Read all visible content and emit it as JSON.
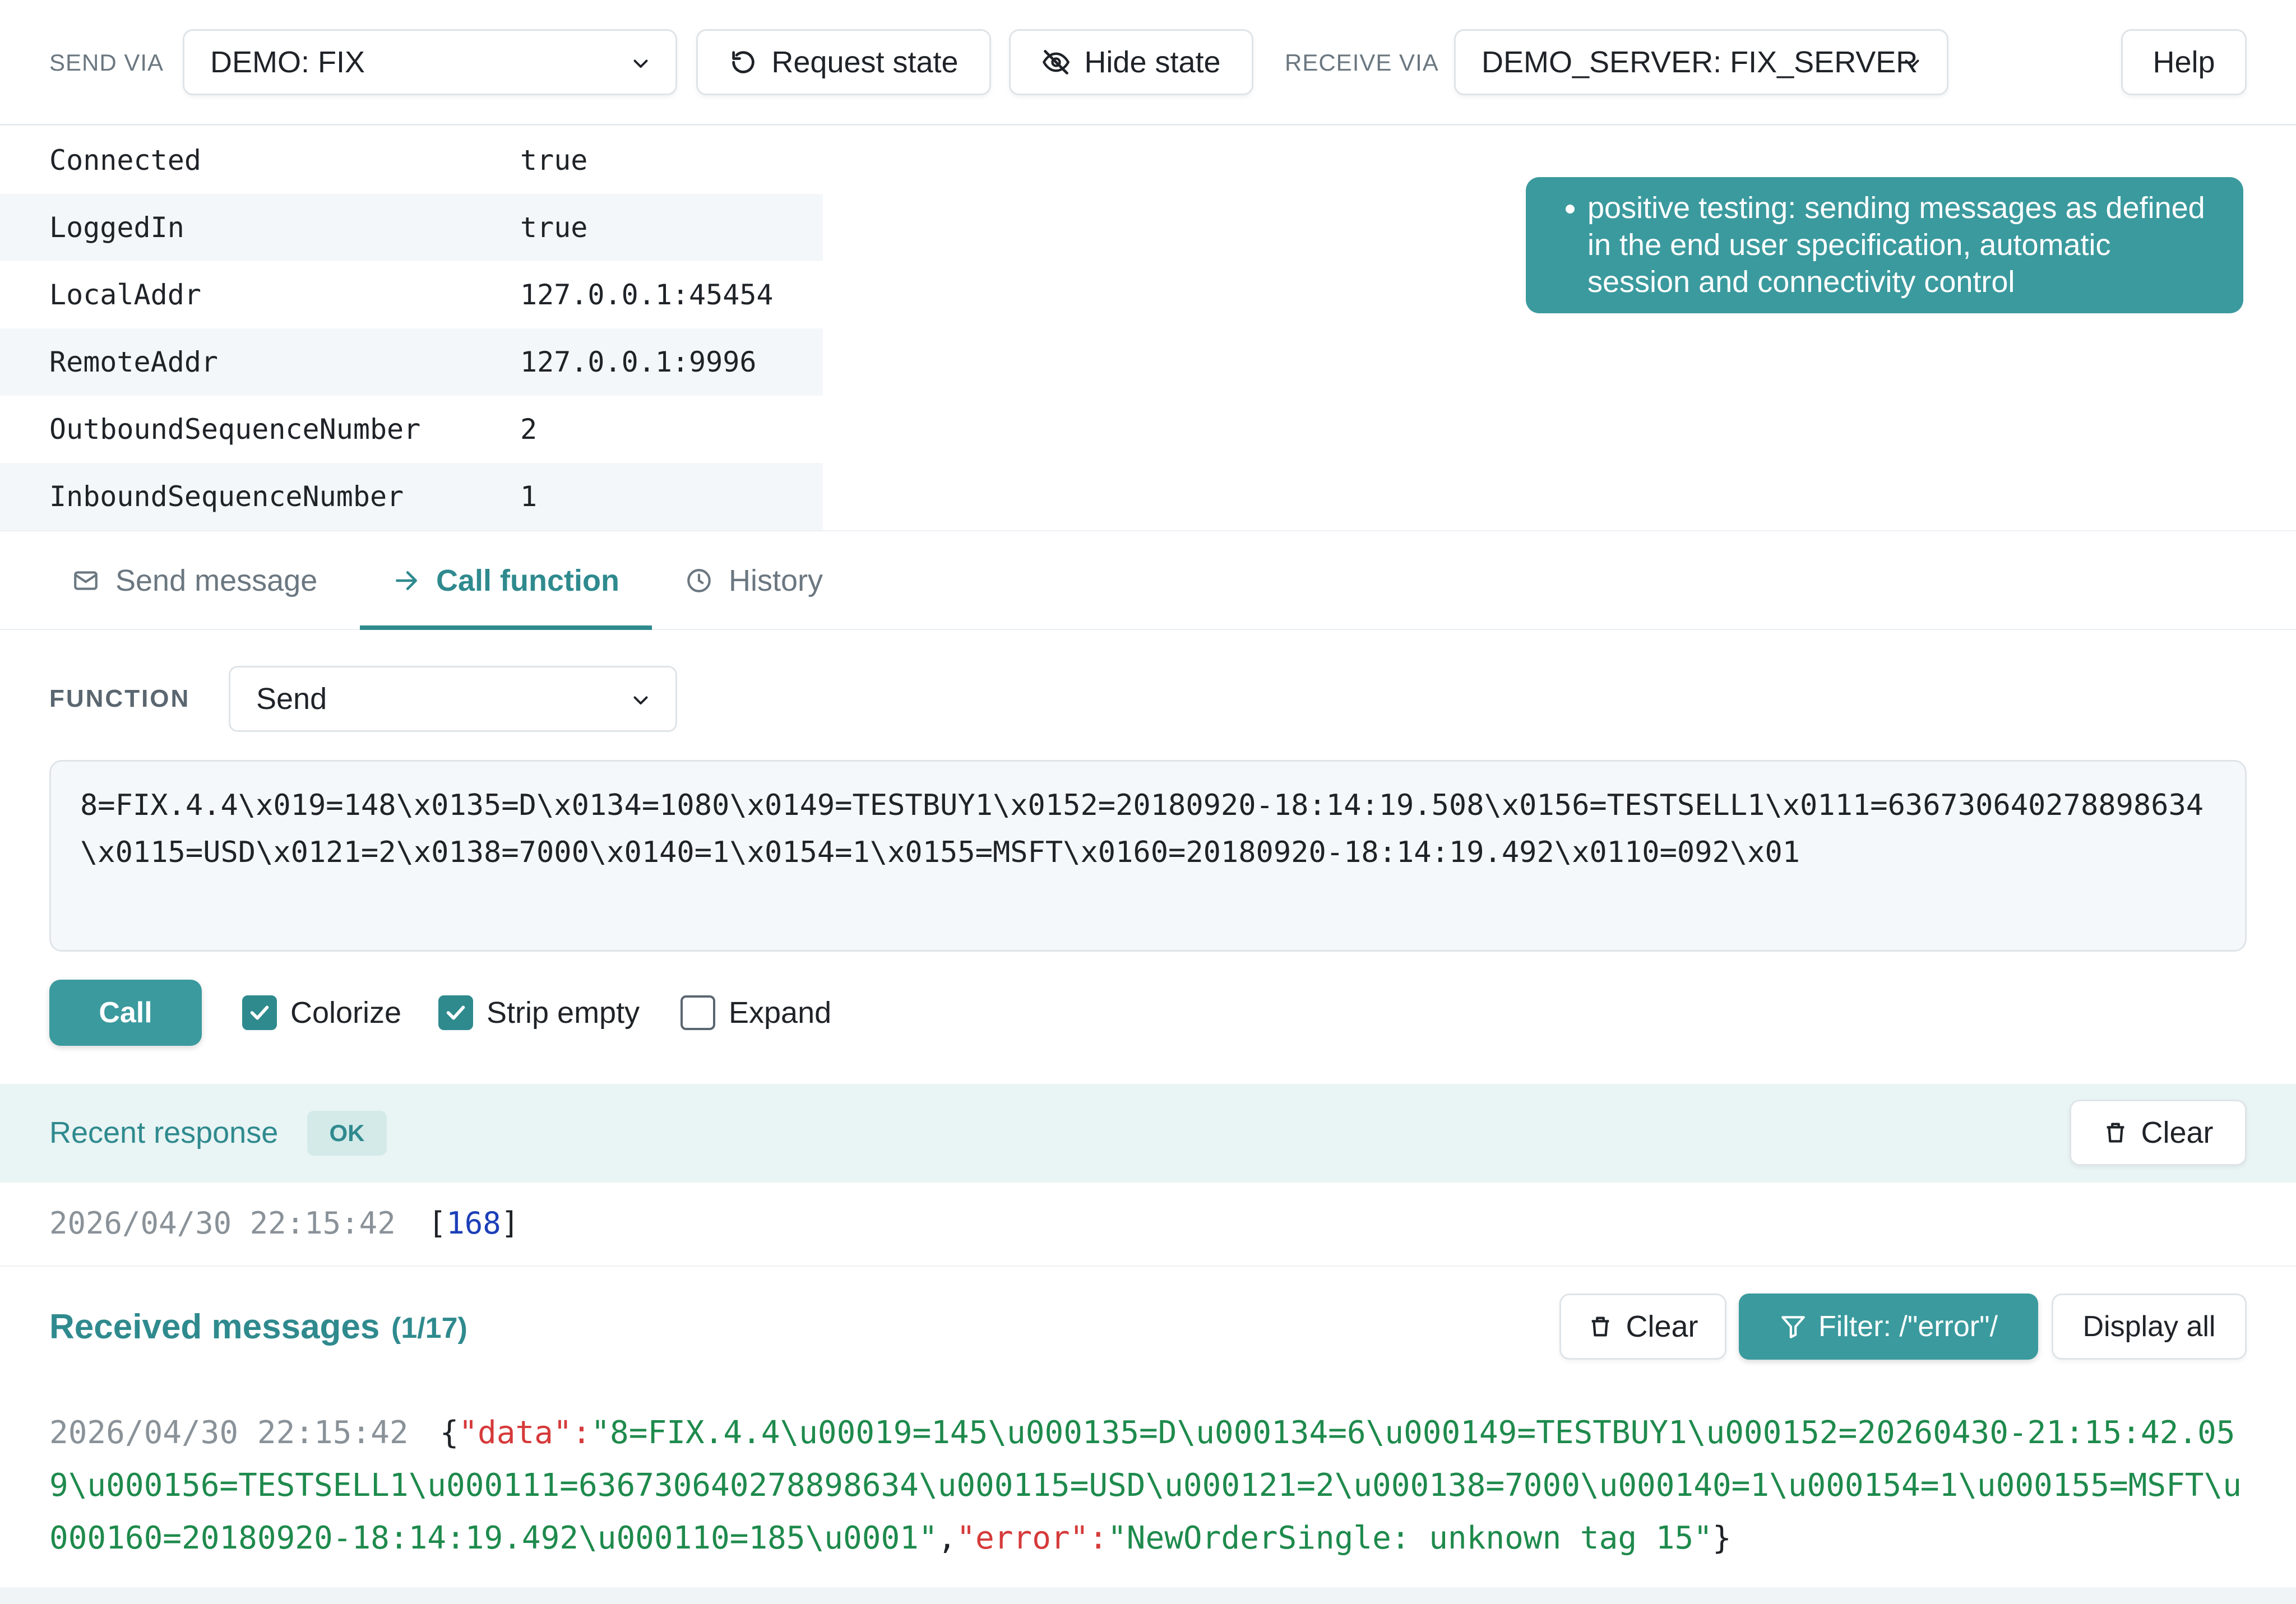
{
  "toolbar": {
    "send_via_label": "SEND VIA",
    "send_via_value": "DEMO: FIX",
    "request_state_label": "Request state",
    "hide_state_label": "Hide state",
    "receive_via_label": "RECEIVE VIA",
    "receive_via_value": "DEMO_SERVER: FIX_SERVER",
    "help_label": "Help"
  },
  "state": [
    {
      "key": "Connected",
      "value": "true"
    },
    {
      "key": "LoggedIn",
      "value": "true"
    },
    {
      "key": "LocalAddr",
      "value": "127.0.0.1:45454"
    },
    {
      "key": "RemoteAddr",
      "value": "127.0.0.1:9996"
    },
    {
      "key": "OutboundSequenceNumber",
      "value": "2"
    },
    {
      "key": "InboundSequenceNumber",
      "value": "1"
    }
  ],
  "note": {
    "text": "positive testing: sending messages as defined in the end user specification, automatic session and connectivity control"
  },
  "tabs": [
    {
      "label": "Send message",
      "icon": "mail-icon",
      "active": false
    },
    {
      "label": "Call function",
      "icon": "arrow-right-icon",
      "active": true
    },
    {
      "label": "History",
      "icon": "clock-icon",
      "active": false
    }
  ],
  "function": {
    "label": "FUNCTION",
    "selected": "Send",
    "editor_value": "8=FIX.4.4\\x019=148\\x0135=D\\x0134=1080\\x0149=TESTBUY1\\x0152=20180920-18:14:19.508\\x0156=TESTSELL1\\x0111=636730640278898634\\x0115=USD\\x0121=2\\x0138=7000\\x0140=1\\x0154=1\\x0155=MSFT\\x0160=20180920-18:14:19.492\\x0110=092\\x01"
  },
  "call": {
    "button_label": "Call",
    "colorize_label": "Colorize",
    "colorize_checked": true,
    "strip_empty_label": "Strip empty",
    "strip_empty_checked": true,
    "expand_label": "Expand",
    "expand_checked": false
  },
  "recent_response": {
    "title": "Recent response",
    "badge": "OK",
    "clear_label": "Clear",
    "timestamp": "2026/04/30 22:15:42",
    "open_bracket": "[",
    "value": "168",
    "close_bracket": "]"
  },
  "received": {
    "title": "Received messages",
    "count": "(1/17)",
    "clear_label": "Clear",
    "filter_label": "Filter: /\"error\"/",
    "display_all_label": "Display all",
    "message": {
      "timestamp": "2026/04/30 22:15:42",
      "open_brace": "{",
      "data_key": "\"data\"",
      "colon1": ":",
      "data_value": "\"8=FIX.4.4\\u00019=145\\u000135=D\\u000134=6\\u000149=TESTBUY1\\u000152=20260430-21:15:42.059\\u000156=TESTSELL1\\u000111=636730640278898634\\u000115=USD\\u000121=2\\u000138=7000\\u000140=1\\u000154=1\\u000155=MSFT\\u000160=20180920-18:14:19.492\\u000110=185\\u0001\"",
      "comma": ",",
      "error_key": "\"error\"",
      "colon2": ":",
      "error_value": "\"NewOrderSingle: unknown tag 15\"",
      "close_brace": "}"
    }
  },
  "colors": {
    "accent": "#3b9a9e",
    "accent_text": "#2f8a8e",
    "json_key": "#d63a3a",
    "json_value": "#1e8a4c",
    "number": "#1c3fb8"
  }
}
